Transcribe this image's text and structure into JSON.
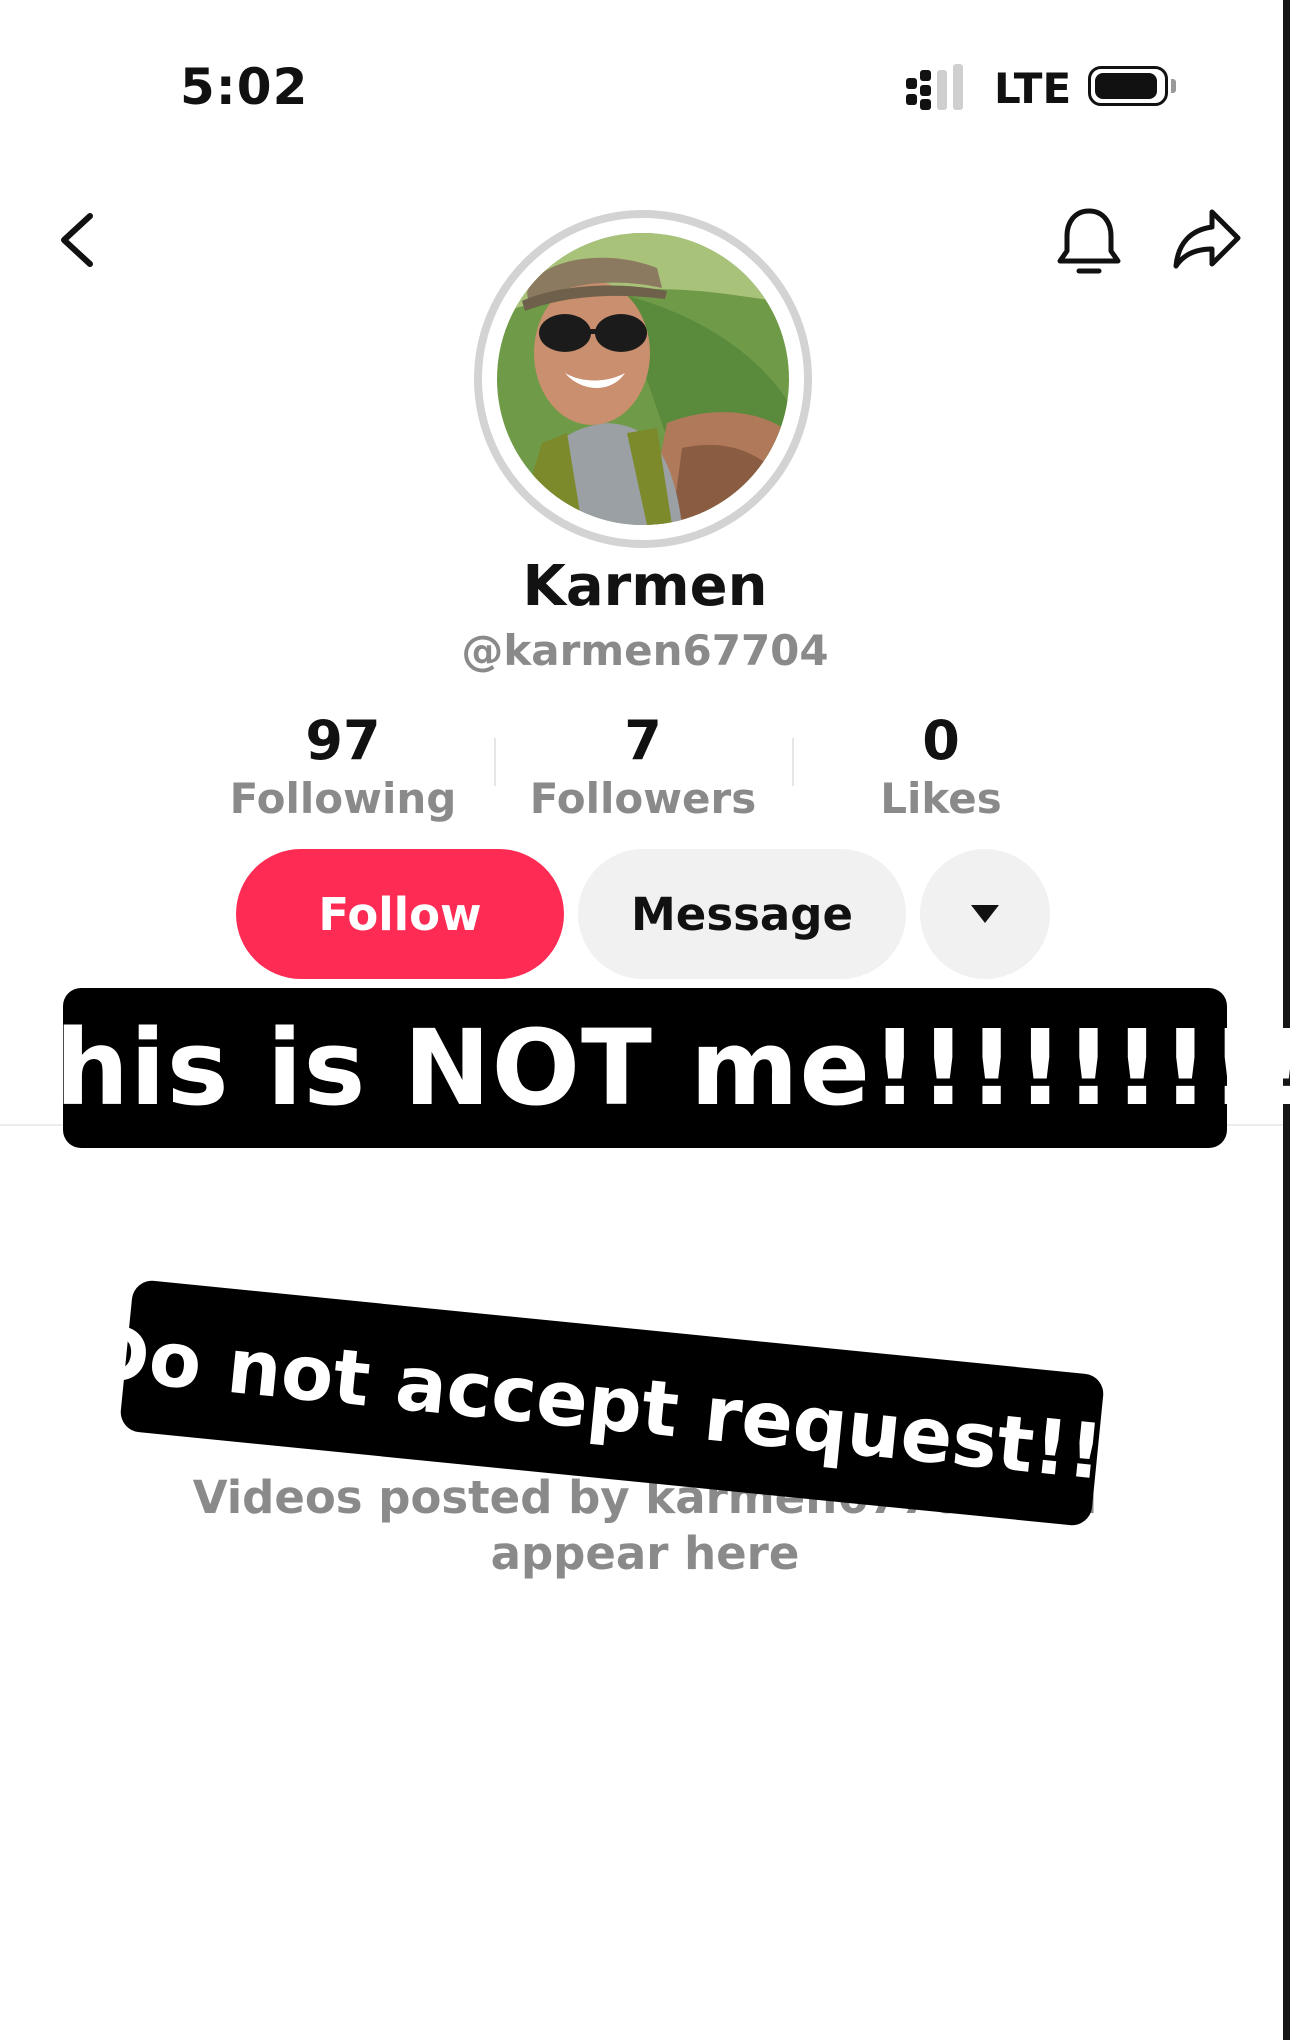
{
  "status_bar": {
    "time": "5:02",
    "network": "LTE",
    "icons": [
      "cellular-signal-icon",
      "battery-icon"
    ]
  },
  "nav": {
    "icons": [
      "back-chevron-icon",
      "bell-icon",
      "share-arrow-icon"
    ]
  },
  "profile": {
    "display_name": "Karmen",
    "handle": "@karmen67704",
    "stats": [
      {
        "value": "97",
        "label": "Following"
      },
      {
        "value": "7",
        "label": "Followers"
      },
      {
        "value": "0",
        "label": "Likes"
      }
    ]
  },
  "actions": {
    "follow_label": "Follow",
    "message_label": "Message"
  },
  "empty_state": {
    "text": "Videos posted by karmen67704 will appear here"
  },
  "captions": {
    "first": "This is NOT me!!!!!!!!!",
    "second": "Do not accept request!!!"
  },
  "colors": {
    "follow_button": "#fe2c55",
    "secondary_button": "#f1f1f2",
    "muted_text": "#8a8a8a",
    "caption_background": "#000000"
  }
}
